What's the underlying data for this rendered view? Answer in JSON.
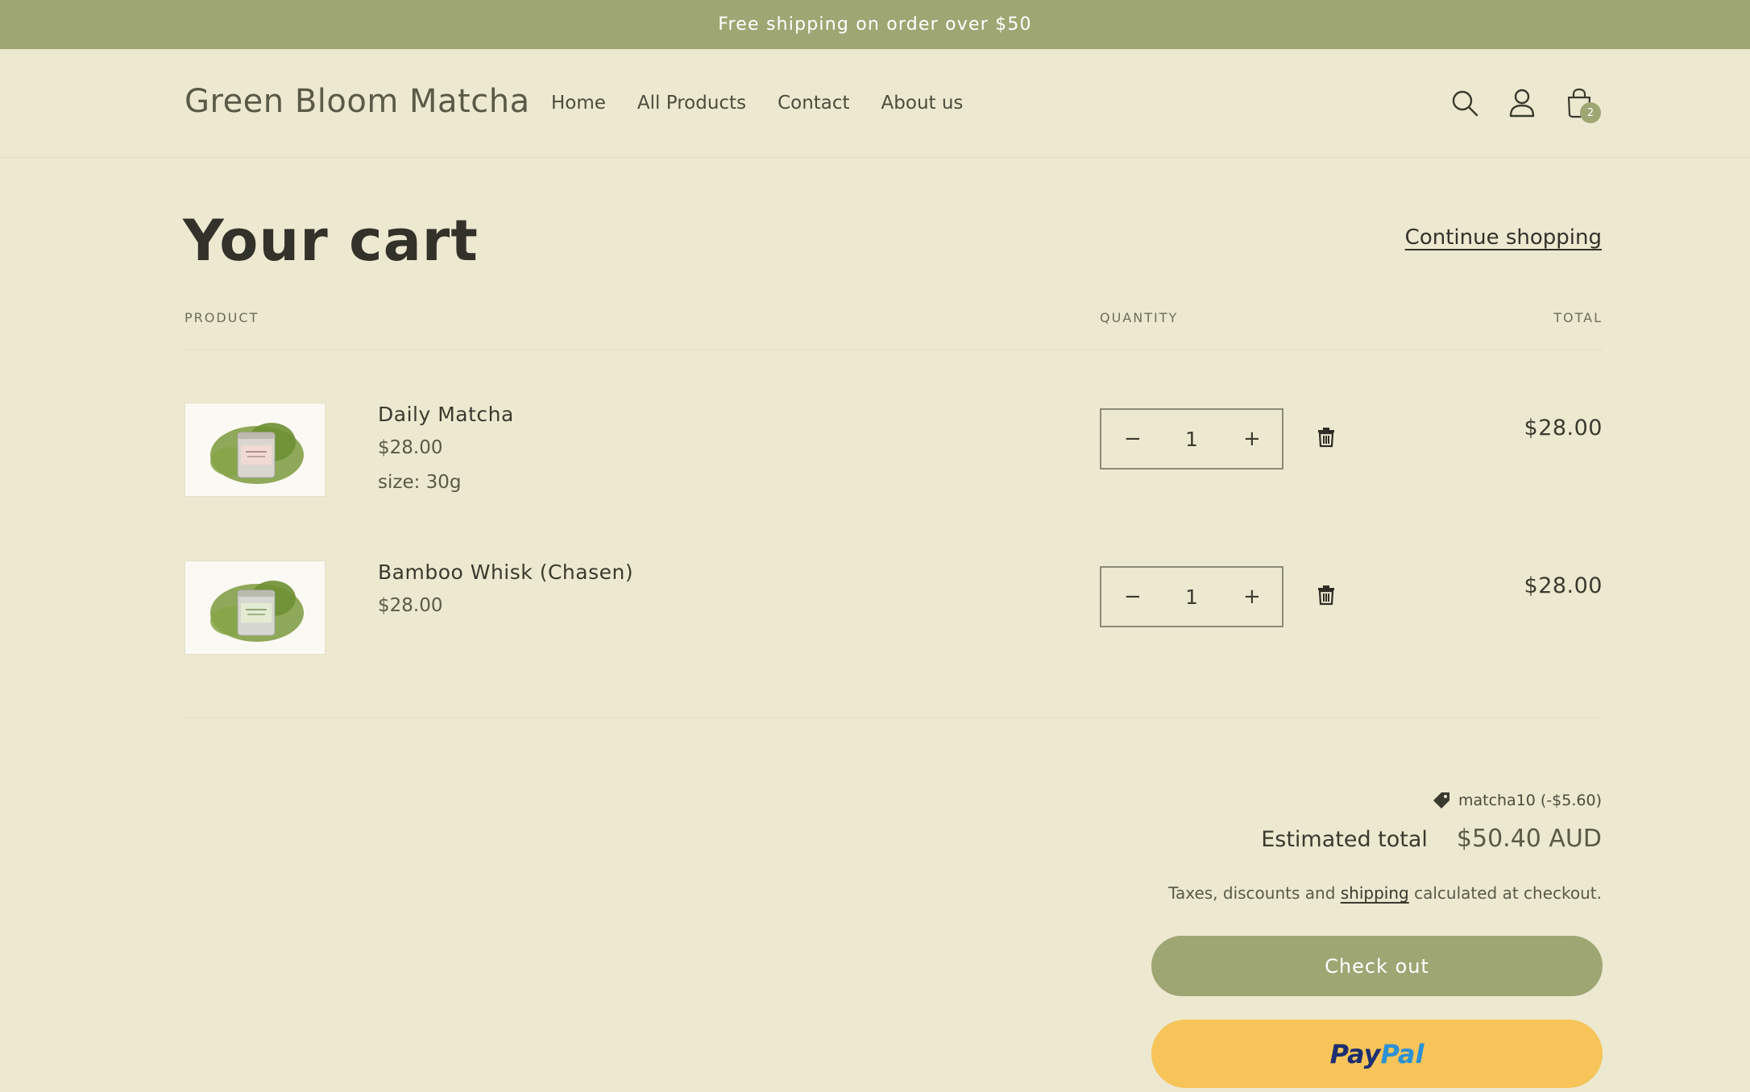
{
  "announcement": "Free shipping on order over $50",
  "header": {
    "logo": "Green Bloom Matcha",
    "nav": [
      "Home",
      "All Products",
      "Contact",
      "About us"
    ],
    "cart_count": "2"
  },
  "cart": {
    "title": "Your cart",
    "continue_label": "Continue shopping",
    "columns": {
      "product": "PRODUCT",
      "quantity": "QUANTITY",
      "total": "TOTAL"
    },
    "items": [
      {
        "name": "Daily Matcha",
        "price": "$28.00",
        "variant": "size: 30g",
        "quantity": "1",
        "line_total": "$28.00"
      },
      {
        "name": "Bamboo Whisk (Chasen)",
        "price": "$28.00",
        "quantity": "1",
        "line_total": "$28.00"
      }
    ],
    "minus_symbol": "−",
    "plus_symbol": "+"
  },
  "summary": {
    "discount": "matcha10 (-$5.60)",
    "estimated_label": "Estimated total",
    "estimated_value": "$50.40 AUD",
    "taxes_before": "Taxes, discounts and ",
    "taxes_link": "shipping",
    "taxes_after": " calculated at checkout.",
    "checkout_label": "Check out",
    "paypal_part1": "Pay",
    "paypal_part2": "Pal"
  },
  "colors": {
    "accent": "#9ea673",
    "background": "#ede8d0",
    "paypal": "#f6c458"
  },
  "icons": [
    "search-icon",
    "account-icon",
    "cart-icon",
    "trash-icon",
    "tag-icon"
  ]
}
